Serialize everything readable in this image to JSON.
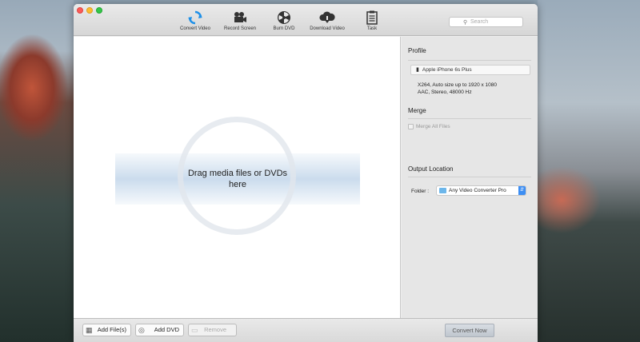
{
  "toolbar": {
    "items": [
      {
        "label": "Convert Video",
        "icon": "convert-video-icon"
      },
      {
        "label": "Record Screen",
        "icon": "record-screen-icon"
      },
      {
        "label": "Burn DVD",
        "icon": "burn-dvd-icon"
      },
      {
        "label": "Download Video",
        "icon": "download-video-icon"
      },
      {
        "label": "Task",
        "icon": "task-icon"
      }
    ],
    "search_placeholder": "Search"
  },
  "main": {
    "drop_text_line1": "Drag media files or DVDs",
    "drop_text_line2": "here"
  },
  "sidebar": {
    "profile_title": "Profile",
    "profile_value": "Apple iPhone 6s Plus",
    "profile_desc_line1": "X264, Auto size up to 1920 x 1080",
    "profile_desc_line2": "AAC, Stereo, 48000 Hz",
    "merge_title": "Merge",
    "merge_label": "Merge All Files",
    "output_title": "Output Location",
    "folder_label": "Folder :",
    "folder_value": "Any Video Converter Pro"
  },
  "bottom": {
    "add_files_label": "Add File(s)",
    "add_dvd_label": "Add DVD",
    "remove_label": "Remove",
    "convert_label": "Convert Now"
  },
  "colors": {
    "accent": "#1e90e8",
    "convert_icon": "#1e90e8",
    "close": "#fc5b57",
    "minimize": "#fdbc2e",
    "maximize": "#33c748"
  }
}
